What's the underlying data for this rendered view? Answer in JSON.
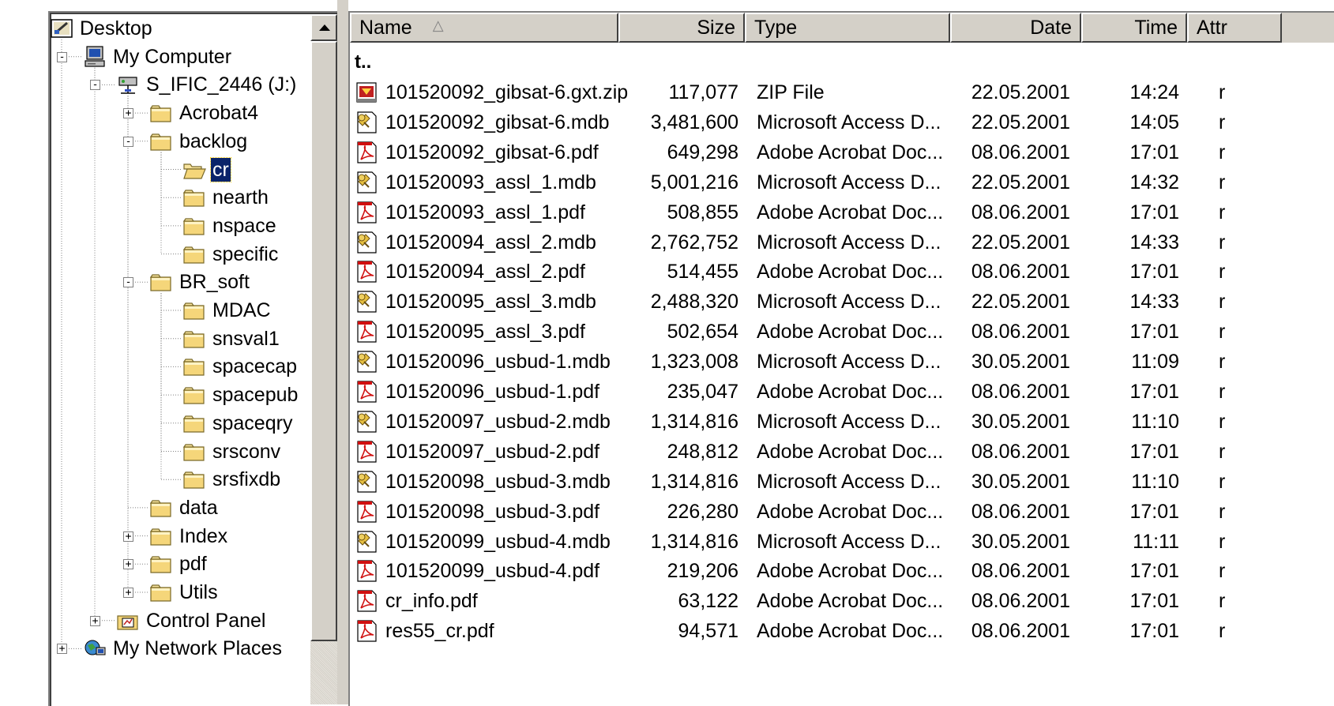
{
  "tree": {
    "items": [
      {
        "label": "Desktop",
        "icon": "desktop-icon",
        "depth": 0,
        "expander": null
      },
      {
        "label": "My Computer",
        "icon": "computer-icon",
        "depth": 1,
        "expander": "-"
      },
      {
        "label": "S_IFIC_2446 (J:)",
        "icon": "network-drive-icon",
        "depth": 2,
        "expander": "-"
      },
      {
        "label": "Acrobat4",
        "icon": "folder-icon",
        "depth": 3,
        "expander": "+"
      },
      {
        "label": "backlog",
        "icon": "folder-icon",
        "depth": 3,
        "expander": "-"
      },
      {
        "label": "cr",
        "icon": "open-folder-icon",
        "depth": 4,
        "expander": null,
        "selected": true
      },
      {
        "label": "nearth",
        "icon": "folder-icon",
        "depth": 4,
        "expander": null
      },
      {
        "label": "nspace",
        "icon": "folder-icon",
        "depth": 4,
        "expander": null
      },
      {
        "label": "specific",
        "icon": "folder-icon",
        "depth": 4,
        "expander": null
      },
      {
        "label": "BR_soft",
        "icon": "folder-icon",
        "depth": 3,
        "expander": "-"
      },
      {
        "label": "MDAC",
        "icon": "folder-icon",
        "depth": 4,
        "expander": null
      },
      {
        "label": "snsval1",
        "icon": "folder-icon",
        "depth": 4,
        "expander": null
      },
      {
        "label": "spacecap",
        "icon": "folder-icon",
        "depth": 4,
        "expander": null
      },
      {
        "label": "spacepub",
        "icon": "folder-icon",
        "depth": 4,
        "expander": null
      },
      {
        "label": "spaceqry",
        "icon": "folder-icon",
        "depth": 4,
        "expander": null
      },
      {
        "label": "srsconv",
        "icon": "folder-icon",
        "depth": 4,
        "expander": null
      },
      {
        "label": "srsfixdb",
        "icon": "folder-icon",
        "depth": 4,
        "expander": null
      },
      {
        "label": "data",
        "icon": "folder-icon",
        "depth": 3,
        "expander": null
      },
      {
        "label": "Index",
        "icon": "folder-icon",
        "depth": 3,
        "expander": "+"
      },
      {
        "label": "pdf",
        "icon": "folder-icon",
        "depth": 3,
        "expander": "+"
      },
      {
        "label": "Utils",
        "icon": "folder-icon",
        "depth": 3,
        "expander": "+"
      },
      {
        "label": "Control Panel",
        "icon": "control-panel-icon",
        "depth": 2,
        "expander": "+"
      },
      {
        "label": "My Network Places",
        "icon": "network-places-icon",
        "depth": 1,
        "expander": "+"
      }
    ]
  },
  "list": {
    "columns": {
      "name": "Name",
      "size": "Size",
      "type": "Type",
      "date": "Date",
      "time": "Time",
      "attr": "Attr"
    },
    "sort_indicator": "△",
    "up_label": "t..",
    "files": [
      {
        "name": "101520092_gibsat-6.gxt.zip",
        "size": "117,077",
        "type": "ZIP File",
        "date": "22.05.2001",
        "time": "14:24",
        "attr": "r",
        "icon": "zip-file-icon"
      },
      {
        "name": "101520092_gibsat-6.mdb",
        "size": "3,481,600",
        "type": "Microsoft Access D...",
        "date": "22.05.2001",
        "time": "14:05",
        "attr": "r",
        "icon": "access-db-icon"
      },
      {
        "name": "101520092_gibsat-6.pdf",
        "size": "649,298",
        "type": "Adobe Acrobat Doc...",
        "date": "08.06.2001",
        "time": "17:01",
        "attr": "r",
        "icon": "pdf-icon"
      },
      {
        "name": "101520093_assl_1.mdb",
        "size": "5,001,216",
        "type": "Microsoft Access D...",
        "date": "22.05.2001",
        "time": "14:32",
        "attr": "r",
        "icon": "access-db-icon"
      },
      {
        "name": "101520093_assl_1.pdf",
        "size": "508,855",
        "type": "Adobe Acrobat Doc...",
        "date": "08.06.2001",
        "time": "17:01",
        "attr": "r",
        "icon": "pdf-icon"
      },
      {
        "name": "101520094_assl_2.mdb",
        "size": "2,762,752",
        "type": "Microsoft Access D...",
        "date": "22.05.2001",
        "time": "14:33",
        "attr": "r",
        "icon": "access-db-icon"
      },
      {
        "name": "101520094_assl_2.pdf",
        "size": "514,455",
        "type": "Adobe Acrobat Doc...",
        "date": "08.06.2001",
        "time": "17:01",
        "attr": "r",
        "icon": "pdf-icon"
      },
      {
        "name": "101520095_assl_3.mdb",
        "size": "2,488,320",
        "type": "Microsoft Access D...",
        "date": "22.05.2001",
        "time": "14:33",
        "attr": "r",
        "icon": "access-db-icon"
      },
      {
        "name": "101520095_assl_3.pdf",
        "size": "502,654",
        "type": "Adobe Acrobat Doc...",
        "date": "08.06.2001",
        "time": "17:01",
        "attr": "r",
        "icon": "pdf-icon"
      },
      {
        "name": "101520096_usbud-1.mdb",
        "size": "1,323,008",
        "type": "Microsoft Access D...",
        "date": "30.05.2001",
        "time": "11:09",
        "attr": "r",
        "icon": "access-db-icon"
      },
      {
        "name": "101520096_usbud-1.pdf",
        "size": "235,047",
        "type": "Adobe Acrobat Doc...",
        "date": "08.06.2001",
        "time": "17:01",
        "attr": "r",
        "icon": "pdf-icon"
      },
      {
        "name": "101520097_usbud-2.mdb",
        "size": "1,314,816",
        "type": "Microsoft Access D...",
        "date": "30.05.2001",
        "time": "11:10",
        "attr": "r",
        "icon": "access-db-icon"
      },
      {
        "name": "101520097_usbud-2.pdf",
        "size": "248,812",
        "type": "Adobe Acrobat Doc...",
        "date": "08.06.2001",
        "time": "17:01",
        "attr": "r",
        "icon": "pdf-icon"
      },
      {
        "name": "101520098_usbud-3.mdb",
        "size": "1,314,816",
        "type": "Microsoft Access D...",
        "date": "30.05.2001",
        "time": "11:10",
        "attr": "r",
        "icon": "access-db-icon"
      },
      {
        "name": "101520098_usbud-3.pdf",
        "size": "226,280",
        "type": "Adobe Acrobat Doc...",
        "date": "08.06.2001",
        "time": "17:01",
        "attr": "r",
        "icon": "pdf-icon"
      },
      {
        "name": "101520099_usbud-4.mdb",
        "size": "1,314,816",
        "type": "Microsoft Access D...",
        "date": "30.05.2001",
        "time": "11:11",
        "attr": "r",
        "icon": "access-db-icon"
      },
      {
        "name": "101520099_usbud-4.pdf",
        "size": "219,206",
        "type": "Adobe Acrobat Doc...",
        "date": "08.06.2001",
        "time": "17:01",
        "attr": "r",
        "icon": "pdf-icon"
      },
      {
        "name": "cr_info.pdf",
        "size": "63,122",
        "type": "Adobe Acrobat Doc...",
        "date": "08.06.2001",
        "time": "17:01",
        "attr": "r",
        "icon": "pdf-icon"
      },
      {
        "name": "res55_cr.pdf",
        "size": "94,571",
        "type": "Adobe Acrobat Doc...",
        "date": "08.06.2001",
        "time": "17:01",
        "attr": "r",
        "icon": "pdf-icon"
      }
    ]
  },
  "colors": {
    "selection_bg": "#0a246a",
    "folder_yellow": "#f5d67a",
    "pdf_red": "#d01010",
    "face": "#d4d0c8"
  }
}
